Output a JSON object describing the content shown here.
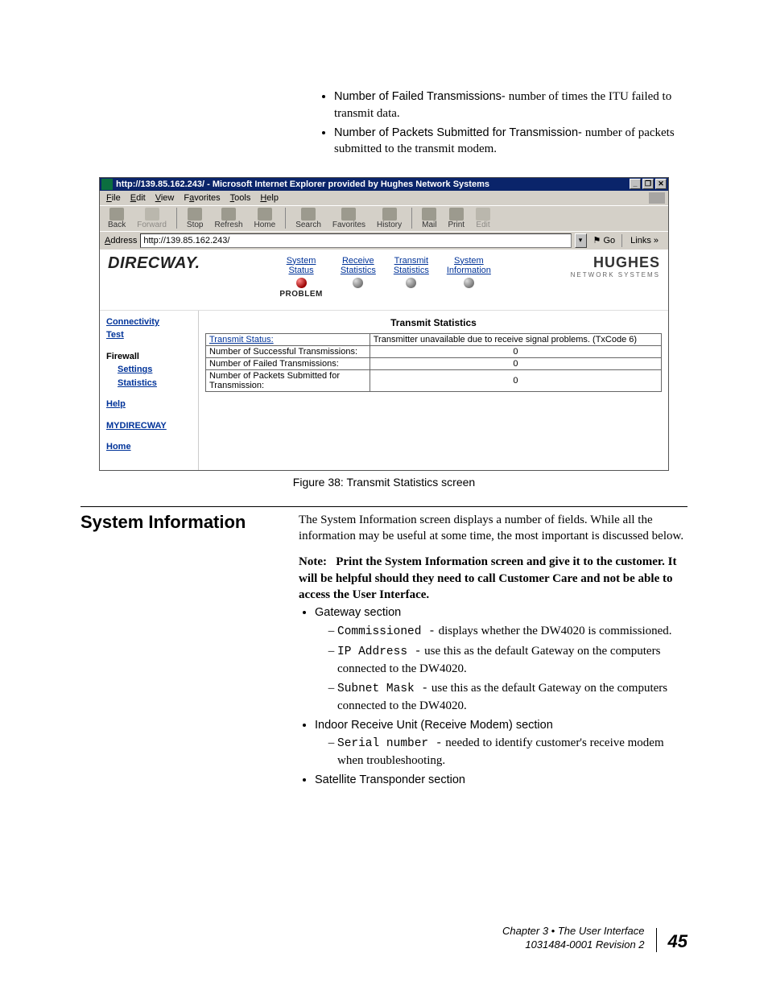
{
  "top_bullets": [
    {
      "term": "Number of Failed Transmissions- ",
      "desc": "number of times the ITU failed to transmit data."
    },
    {
      "term": "Number of Packets Submitted for Transmission- ",
      "desc": "number of packets submitted to the transmit modem."
    }
  ],
  "browser": {
    "title": "http://139.85.162.243/ - Microsoft Internet Explorer provided by Hughes Network Systems",
    "win_min": "_",
    "win_max": "❐",
    "win_close": "✕",
    "menu_file": "File",
    "menu_edit": "Edit",
    "menu_view": "View",
    "menu_fav": "Favorites",
    "menu_tools": "Tools",
    "menu_help": "Help",
    "tb_back": "Back",
    "tb_forward": "Forward",
    "tb_stop": "Stop",
    "tb_refresh": "Refresh",
    "tb_home": "Home",
    "tb_search": "Search",
    "tb_favorites": "Favorites",
    "tb_history": "History",
    "tb_mail": "Mail",
    "tb_print": "Print",
    "tb_edit": "Edit",
    "addr_label": "Address",
    "addr_value": "http://139.85.162.243/",
    "go": "Go",
    "links": "Links »"
  },
  "app": {
    "logo": "DIRECWAY.",
    "nav": {
      "system_status_1": "System",
      "system_status_2": "Status",
      "problem": "PROBLEM",
      "rx_1": "Receive",
      "rx_2": "Statistics",
      "tx_1": "Transmit",
      "tx_2": "Statistics",
      "si_1": "System",
      "si_2": "Information"
    },
    "hughes_1": "HUGHES",
    "hughes_2": "NETWORK SYSTEMS",
    "sidebar": {
      "conn_1": "Connectivity",
      "conn_2": "Test",
      "firewall": "Firewall",
      "settings": "Settings",
      "statistics": "Statistics",
      "help": "Help",
      "mydirecway": "MYDIRECWAY",
      "home": "Home"
    },
    "pane_title": "Transmit Statistics",
    "rows": [
      {
        "label": "Transmit Status:",
        "link": true,
        "value": "Transmitter unavailable due to receive signal problems. (TxCode 6)",
        "align": "left"
      },
      {
        "label": "Number of Successful Transmissions:",
        "link": false,
        "value": "0",
        "align": "center"
      },
      {
        "label": "Number of Failed Transmissions:",
        "link": false,
        "value": "0",
        "align": "center"
      },
      {
        "label": "Number of Packets Submitted for Transmission:",
        "link": false,
        "value": "0",
        "align": "center"
      }
    ]
  },
  "figure_caption": "Figure 38:  Transmit Statistics screen",
  "section": {
    "title": "System Information",
    "intro": "The System Information screen displays a number of fields. While all the information may be useful at some time, the most important is discussed below.",
    "note_label": "Note:",
    "note_text": "Print the System Information screen and give it to the customer. It will be helpful should they need to call Customer Care and not be able to access the User Interface.",
    "b1_head": "Gateway section",
    "b1_items": [
      {
        "code": "Commissioned -",
        "text": " displays whether the DW4020 is commissioned."
      },
      {
        "code": "IP Address -",
        "text": " use this as the default Gateway on the computers connected to the DW4020."
      },
      {
        "code": "Subnet Mask -",
        "text": " use this as the default Gateway on the computers connected to the DW4020."
      }
    ],
    "b2_head": "Indoor Receive Unit (Receive Modem) section",
    "b2_items": [
      {
        "code": "Serial number -",
        "text": " needed to identify customer's receive modem when troubleshooting."
      }
    ],
    "b3_head": "Satellite Transponder section"
  },
  "footer": {
    "chapter": "Chapter 3 • The User Interface",
    "docnum": "1031484-0001   Revision 2",
    "page": "45"
  }
}
